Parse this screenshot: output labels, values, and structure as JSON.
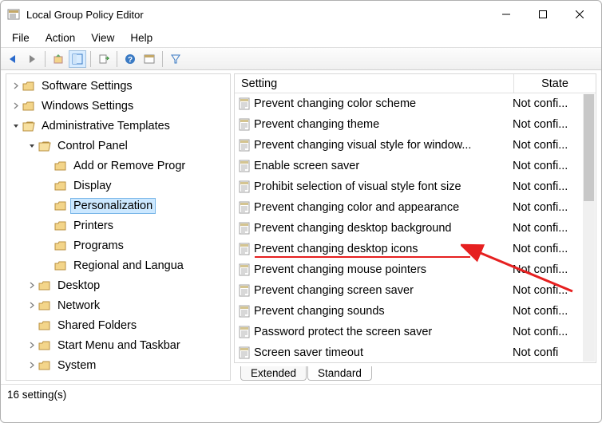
{
  "window": {
    "title": "Local Group Policy Editor",
    "minimize": "–",
    "maximize": "▢",
    "close": "✕"
  },
  "menu": {
    "file": "File",
    "action": "Action",
    "view": "View",
    "help": "Help"
  },
  "tree": {
    "items": [
      {
        "label": "Software Settings",
        "indent": 1,
        "chev": "closed",
        "open": false,
        "sel": false
      },
      {
        "label": "Windows Settings",
        "indent": 1,
        "chev": "closed",
        "open": false,
        "sel": false
      },
      {
        "label": "Administrative Templates",
        "indent": 1,
        "chev": "open",
        "open": true,
        "sel": false
      },
      {
        "label": "Control Panel",
        "indent": 2,
        "chev": "open",
        "open": true,
        "sel": false
      },
      {
        "label": "Add or Remove Progr",
        "indent": 3,
        "chev": "none",
        "open": false,
        "sel": false
      },
      {
        "label": "Display",
        "indent": 3,
        "chev": "none",
        "open": false,
        "sel": false
      },
      {
        "label": "Personalization",
        "indent": 3,
        "chev": "none",
        "open": false,
        "sel": true
      },
      {
        "label": "Printers",
        "indent": 3,
        "chev": "none",
        "open": false,
        "sel": false
      },
      {
        "label": "Programs",
        "indent": 3,
        "chev": "none",
        "open": false,
        "sel": false
      },
      {
        "label": "Regional and Langua",
        "indent": 3,
        "chev": "none",
        "open": false,
        "sel": false
      },
      {
        "label": "Desktop",
        "indent": 2,
        "chev": "closed",
        "open": false,
        "sel": false
      },
      {
        "label": "Network",
        "indent": 2,
        "chev": "closed",
        "open": false,
        "sel": false
      },
      {
        "label": "Shared Folders",
        "indent": 2,
        "chev": "none",
        "open": false,
        "sel": false
      },
      {
        "label": "Start Menu and Taskbar",
        "indent": 2,
        "chev": "closed",
        "open": false,
        "sel": false
      },
      {
        "label": "System",
        "indent": 2,
        "chev": "closed",
        "open": false,
        "sel": false
      }
    ]
  },
  "list": {
    "col1": "Setting",
    "col2": "State",
    "rows": [
      {
        "name": "Prevent changing color scheme",
        "state": "Not confi..."
      },
      {
        "name": "Prevent changing theme",
        "state": "Not confi..."
      },
      {
        "name": "Prevent changing visual style for window...",
        "state": "Not confi..."
      },
      {
        "name": "Enable screen saver",
        "state": "Not confi..."
      },
      {
        "name": "Prohibit selection of visual style font size",
        "state": "Not confi..."
      },
      {
        "name": "Prevent changing color and appearance",
        "state": "Not confi..."
      },
      {
        "name": "Prevent changing desktop background",
        "state": "Not confi..."
      },
      {
        "name": "Prevent changing desktop icons",
        "state": "Not confi..."
      },
      {
        "name": "Prevent changing mouse pointers",
        "state": "Not confi..."
      },
      {
        "name": "Prevent changing screen saver",
        "state": "Not confi..."
      },
      {
        "name": "Prevent changing sounds",
        "state": "Not confi..."
      },
      {
        "name": "Password protect the screen saver",
        "state": "Not confi..."
      },
      {
        "name": "Screen saver timeout",
        "state": "Not confi"
      }
    ]
  },
  "tabs": {
    "extended": "Extended",
    "standard": "Standard"
  },
  "status": {
    "text": "16 setting(s)"
  },
  "icons": {
    "folder_closed": "folder-icon",
    "folder_open": "folder-open-icon",
    "setting": "setting-item-icon"
  },
  "annotation": {
    "highlighted_row_index": 7
  }
}
